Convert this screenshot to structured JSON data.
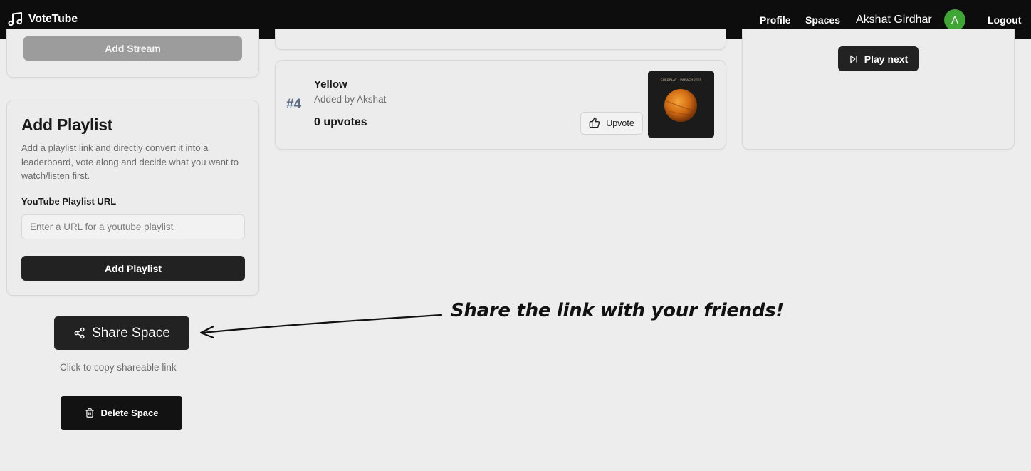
{
  "header": {
    "brand": "VoteTube",
    "nav": {
      "profile": "Profile",
      "spaces": "Spaces"
    },
    "user_name": "Akshat Girdhar",
    "avatar_initial": "A",
    "logout": "Logout"
  },
  "add_stream": {
    "button_label": "Add Stream"
  },
  "add_playlist": {
    "title": "Add Playlist",
    "description": "Add a playlist link and directly convert it into a leaderboard, vote along and decide what you want to watch/listen first.",
    "field_label": "YouTube Playlist URL",
    "placeholder": "Enter a URL for a youtube playlist",
    "value": "",
    "button_label": "Add Playlist"
  },
  "queue": [
    {
      "rank": "#4",
      "title": "Yellow",
      "added_by": "Added by Akshat",
      "upvotes": "0 upvotes",
      "upvote_label": "Upvote",
      "thumbnail_text": "COLDPLAY · PARACHUTES"
    }
  ],
  "now_playing": {
    "play_next_label": "Play next"
  },
  "share": {
    "button_label": "Share Space",
    "hint": "Click to copy shareable link"
  },
  "delete": {
    "button_label": "Delete Space"
  },
  "annotation": {
    "text": "Share the link with your friends!"
  },
  "colors": {
    "topbar": "#0d0d0d",
    "avatar": "#3fa534",
    "button_dark": "#222222",
    "disabled_button": "#9c9c9c",
    "rank": "#5b6b85",
    "background": "#ededed"
  }
}
